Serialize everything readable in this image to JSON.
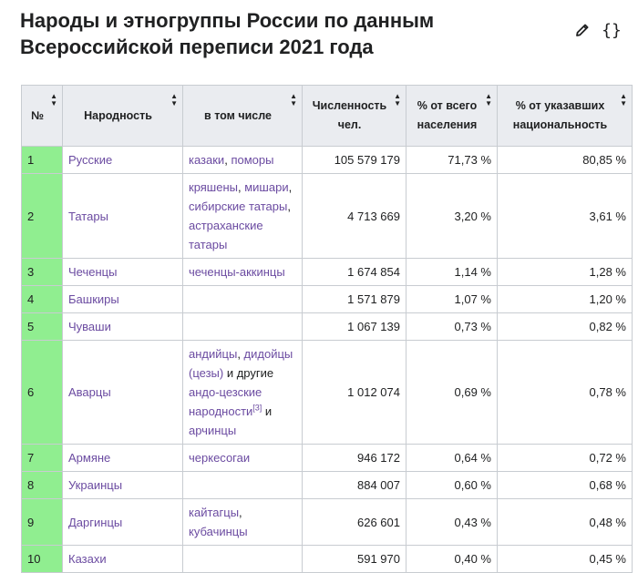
{
  "title": "Народы и этногруппы России по данным Всероссийской переписи 2021 года",
  "tools": {
    "edit_icon": "pencil-icon",
    "source_label": "{}"
  },
  "table": {
    "headers": {
      "num": "№",
      "nation": "Народность",
      "includes": "в том числе",
      "population": "Численность чел.",
      "pct_total": "% от всего населения",
      "pct_specified": "% от указавших национальность"
    },
    "rows": [
      {
        "num": "1",
        "nation": "Русские",
        "includes": [
          {
            "t": "казаки",
            "link": true
          },
          {
            "t": ", ",
            "link": false
          },
          {
            "t": "поморы",
            "link": true
          }
        ],
        "population": "105 579 179",
        "pct_total": "71,73 %",
        "pct_specified": "80,85 %"
      },
      {
        "num": "2",
        "nation": "Татары",
        "includes": [
          {
            "t": "кряшены",
            "link": true
          },
          {
            "t": ", ",
            "link": false
          },
          {
            "t": "мишари",
            "link": true
          },
          {
            "t": ", ",
            "link": false
          },
          {
            "t": "сибирские татары",
            "link": true
          },
          {
            "t": ", ",
            "link": false
          },
          {
            "t": "астраханские татары",
            "link": true
          }
        ],
        "population": "4 713 669",
        "pct_total": "3,20 %",
        "pct_specified": "3,61 %"
      },
      {
        "num": "3",
        "nation": "Чеченцы",
        "includes": [
          {
            "t": "чеченцы-аккинцы",
            "link": true
          }
        ],
        "population": "1 674 854",
        "pct_total": "1,14 %",
        "pct_specified": "1,28 %"
      },
      {
        "num": "4",
        "nation": "Башкиры",
        "includes": [],
        "population": "1 571 879",
        "pct_total": "1,07 %",
        "pct_specified": "1,20 %"
      },
      {
        "num": "5",
        "nation": "Чуваши",
        "includes": [],
        "population": "1 067 139",
        "pct_total": "0,73 %",
        "pct_specified": "0,82 %"
      },
      {
        "num": "6",
        "nation": "Аварцы",
        "includes": [
          {
            "t": "андийцы",
            "link": true
          },
          {
            "t": ", ",
            "link": false
          },
          {
            "t": "дидойцы (цезы)",
            "link": true
          },
          {
            "t": " и другие ",
            "link": false
          },
          {
            "t": "андо-цезские народности",
            "link": true
          },
          {
            "t": "[3]",
            "link": true,
            "sup": true
          },
          {
            "t": " и ",
            "link": false
          },
          {
            "t": "арчинцы",
            "link": true
          }
        ],
        "population": "1 012 074",
        "pct_total": "0,69 %",
        "pct_specified": "0,78 %"
      },
      {
        "num": "7",
        "nation": "Армяне",
        "includes": [
          {
            "t": "черкесогаи",
            "link": true
          }
        ],
        "population": "946 172",
        "pct_total": "0,64 %",
        "pct_specified": "0,72 %"
      },
      {
        "num": "8",
        "nation": "Украинцы",
        "includes": [],
        "population": "884 007",
        "pct_total": "0,60 %",
        "pct_specified": "0,68 %"
      },
      {
        "num": "9",
        "nation": "Даргинцы",
        "includes": [
          {
            "t": "кайтагцы",
            "link": true
          },
          {
            "t": ", ",
            "link": false
          },
          {
            "t": "кубачинцы",
            "link": true
          }
        ],
        "population": "626 601",
        "pct_total": "0,43 %",
        "pct_specified": "0,48 %"
      },
      {
        "num": "10",
        "nation": "Казахи",
        "includes": [],
        "population": "591 970",
        "pct_total": "0,40 %",
        "pct_specified": "0,45 %"
      }
    ]
  },
  "colors": {
    "rank_bg": "#90ee90",
    "link": "#6b4ba1",
    "header_bg": "#eaecf0",
    "border": "#c8ccd1"
  }
}
